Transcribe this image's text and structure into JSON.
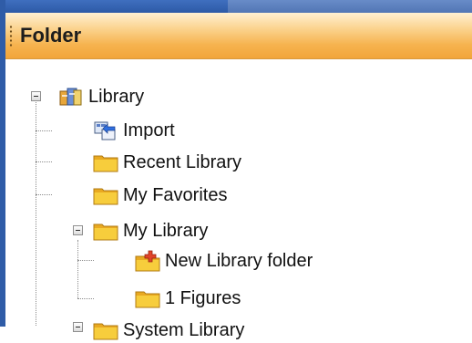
{
  "panel": {
    "title": "Folder"
  },
  "tree": {
    "root": {
      "label": "Library",
      "icon": "library-icon"
    },
    "items": [
      {
        "label": "Import",
        "icon": "import-icon"
      },
      {
        "label": "Recent Library",
        "icon": "folder-icon"
      },
      {
        "label": "My Favorites",
        "icon": "folder-icon"
      },
      {
        "label": "My Library",
        "icon": "folder-icon",
        "children": [
          {
            "label": "New Library folder",
            "icon": "new-folder-icon"
          },
          {
            "label": "1 Figures",
            "icon": "folder-icon"
          }
        ]
      },
      {
        "label": "System Library",
        "icon": "folder-icon"
      }
    ]
  },
  "colors": {
    "header_gradient_top": "#fff0d2",
    "header_gradient_bottom": "#f2a53a",
    "folder_yellow": "#f4c233",
    "frame_blue": "#2f5ca7"
  }
}
